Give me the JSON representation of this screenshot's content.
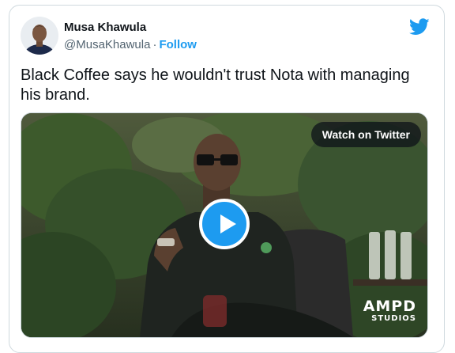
{
  "author": {
    "name": "Musa Khawula",
    "handle": "@MusaKhawula",
    "separator": "·",
    "follow_label": "Follow"
  },
  "tweet": {
    "text": "Black Coffee says he wouldn't trust Nota with managing his brand."
  },
  "media": {
    "watch_label": "Watch on Twitter",
    "watermark_line1": "AMPD",
    "watermark_line2": "STUDIOS"
  },
  "colors": {
    "brand": "#1d9bf0",
    "text": "#0f1419",
    "muted": "#536471",
    "border": "#cfd9de"
  },
  "icons": {
    "brand": "twitter-bird-icon",
    "play": "play-icon"
  }
}
